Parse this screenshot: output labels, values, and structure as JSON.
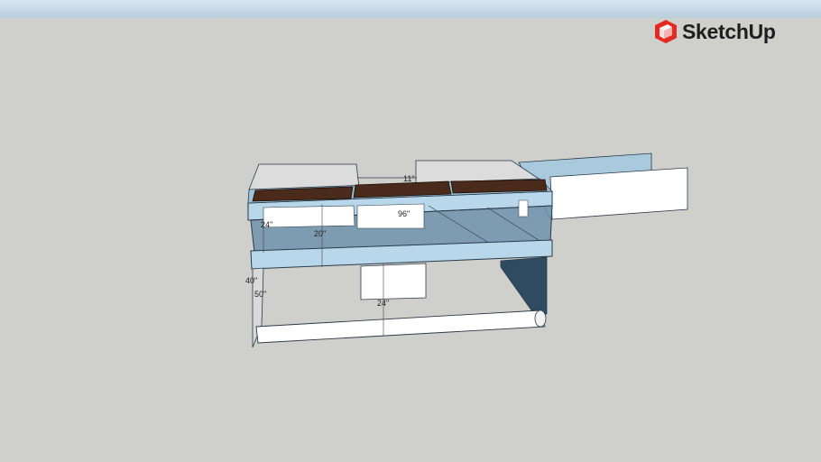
{
  "logo": {
    "text": "SketchUp",
    "icon": "sketchup-logo-icon",
    "color": "#e52a23"
  },
  "colors": {
    "sky": "#c9dce8",
    "ground": "#cfcfcc",
    "glass": "#8fb3c9",
    "frame": "#b8d7ea",
    "soil": "#4a2a1a",
    "edge": "#2a3a48",
    "panel": "#ffffff"
  },
  "dimensions": {
    "top_width": "96\"",
    "top_depth": "11\"",
    "left_depth": "24\"",
    "inner_height": "20\"",
    "leg_height_a": "40\"",
    "leg_height_b": "50\"",
    "base_depth": "24\""
  }
}
